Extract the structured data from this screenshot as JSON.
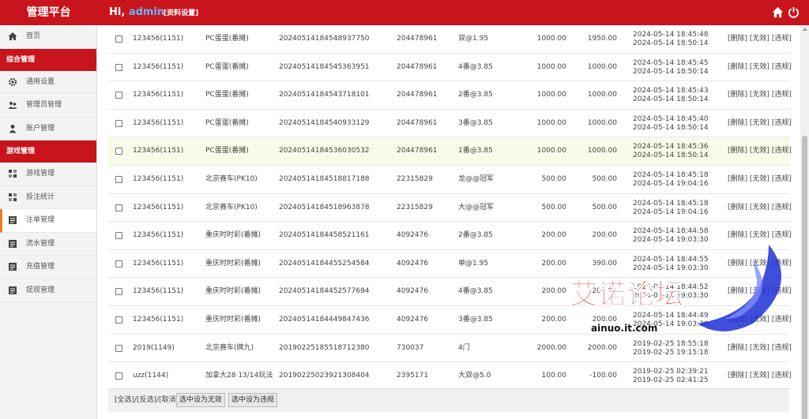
{
  "header": {
    "brand": "管理平台",
    "greeting_prefix": "Hi, ",
    "username": "admin",
    "settings_link": "[资料设置]"
  },
  "sidebar": {
    "home": "首页",
    "section1": "综合管理",
    "general_settings": "通用设置",
    "admin_management": "管理员管理",
    "account_management": "账户管理",
    "section2": "游戏管理",
    "game_management": "游戏管理",
    "bet_statistics": "投注统计",
    "bet_management": "注单管理",
    "flow_management": "流水管理",
    "recharge_management": "充值管理",
    "withdraw_management": "提现管理"
  },
  "rows": [
    {
      "user": "123456(1151)",
      "game": "PC蛋蛋(番摊)",
      "order": "20240514184548937750",
      "issue": "204478961",
      "bet": "双@1.95",
      "amount": "1000.00",
      "win": "1950.00",
      "t1": "2024-05-14 18:45:48",
      "t2": "2024-05-14 18:50:14"
    },
    {
      "user": "123456(1151)",
      "game": "PC蛋蛋(番摊)",
      "order": "20240514184545363951",
      "issue": "204478961",
      "bet": "4番@3.85",
      "amount": "1000.00",
      "win": "1000.00",
      "t1": "2024-05-14 18:45:45",
      "t2": "2024-05-14 18:50:14"
    },
    {
      "user": "123456(1151)",
      "game": "PC蛋蛋(番摊)",
      "order": "20240514184543718101",
      "issue": "204478961",
      "bet": "2番@3.85",
      "amount": "1000.00",
      "win": "1000.00",
      "t1": "2024-05-14 18:45:43",
      "t2": "2024-05-14 18:50:14"
    },
    {
      "user": "123456(1151)",
      "game": "PC蛋蛋(番摊)",
      "order": "20240514184540933129",
      "issue": "204478961",
      "bet": "3番@3.85",
      "amount": "1000.00",
      "win": "1000.00",
      "t1": "2024-05-14 18:45:40",
      "t2": "2024-05-14 18:50:14"
    },
    {
      "user": "123456(1151)",
      "game": "PC蛋蛋(番摊)",
      "order": "20240514184536030532",
      "issue": "204478961",
      "bet": "1番@3.85",
      "amount": "1000.00",
      "win": "1000.00",
      "t1": "2024-05-14 18:45:36",
      "t2": "2024-05-14 18:50:14",
      "highlight": true
    },
    {
      "user": "123456(1151)",
      "game": "北京赛车(PK10)",
      "order": "20240514184518817188",
      "issue": "22315829",
      "bet": "龙@@冠军",
      "amount": "500.00",
      "win": "500.00",
      "t1": "2024-05-14 18:45:18",
      "t2": "2024-05-14 19:04:16"
    },
    {
      "user": "123456(1151)",
      "game": "北京赛车(PK10)",
      "order": "20240514184518963878",
      "issue": "22315829",
      "bet": "大@@冠军",
      "amount": "500.00",
      "win": "500.00",
      "t1": "2024-05-14 18:45:18",
      "t2": "2024-05-14 19:04:16"
    },
    {
      "user": "123456(1151)",
      "game": "重庆时时彩(番摊)",
      "order": "20240514184458521161",
      "issue": "4092476",
      "bet": "2番@3.85",
      "amount": "200.00",
      "win": "200.00",
      "t1": "2024-05-14 18:44:58",
      "t2": "2024-05-14 19:03:30"
    },
    {
      "user": "123456(1151)",
      "game": "重庆时时彩(番摊)",
      "order": "20240514184455254584",
      "issue": "4092476",
      "bet": "单@1.95",
      "amount": "200.00",
      "win": "390.00",
      "t1": "2024-05-14 18:44:55",
      "t2": "2024-05-14 19:03:30"
    },
    {
      "user": "123456(1151)",
      "game": "重庆时时彩(番摊)",
      "order": "20240514184452577694",
      "issue": "4092476",
      "bet": "4番@3.85",
      "amount": "200.00",
      "win": "200.00",
      "t1": "2024-05-14 18:44:52",
      "t2": "2024-05-14 19:03:30"
    },
    {
      "user": "123456(1151)",
      "game": "重庆时时彩(番摊)",
      "order": "20240514184449847436",
      "issue": "4092476",
      "bet": "3番@3.85",
      "amount": "200.00",
      "win": "200.00",
      "t1": "2024-05-14 18:44:49",
      "t2": "2024-05-14 19:03:30"
    },
    {
      "user": "2019(1149)",
      "game": "北京赛车(牌九)",
      "order": "20190225185518712380",
      "issue": "730037",
      "bet": "4门",
      "amount": "2000.00",
      "win": "2000.00",
      "t1": "2019-02-25 18:55:18",
      "t2": "2019-02-25 19:15:18"
    },
    {
      "user": "uzz(1144)",
      "game": "加拿大28 13/14玩法",
      "order": "20190225023921308404",
      "issue": "2395171",
      "bet": "大双@5.0",
      "amount": "100.00",
      "win": "-100.00",
      "t1": "2019-02-25 02:39:21",
      "t2": "2019-02-25 02:41:25"
    }
  ],
  "ops": {
    "delete": "[删除]",
    "invalid": "[无效]",
    "violation": "[违规]"
  },
  "footer": {
    "select_text": "[全选]/[反选]/[取消]",
    "btn_invalid": "选中设为无效",
    "btn_violation": "选中设为违规"
  },
  "watermark": {
    "title": "艾诺论坛",
    "url": "ainuo.it.com"
  },
  "colors": {
    "primary_red": "#c8141c",
    "active_orange": "#f07b20",
    "highlight_row": "#f7fbe8"
  }
}
